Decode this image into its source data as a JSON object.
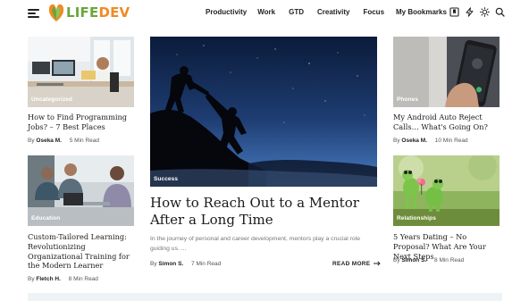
{
  "site": {
    "logo_part1": "LIFE",
    "logo_part2": "DEV",
    "brand_colors": {
      "life": "#6aa63a",
      "dev": "#f08a24"
    }
  },
  "nav": {
    "items": [
      "Productivity",
      "Work",
      "GTD",
      "Creativity",
      "Focus",
      "My Bookmarks"
    ]
  },
  "header_icons": [
    "bookmark-icon",
    "lightning-icon",
    "sun-icon",
    "search-icon"
  ],
  "hamburger_icon": "menu-icon",
  "articles": {
    "left_top": {
      "category": "Uncategorized",
      "title": "How to Find Programming Jobs? – 7 Best Places",
      "by": "By",
      "author": "Oseka M.",
      "read_time": "5 Min Read"
    },
    "left_bottom": {
      "category": "Education",
      "title": "Custom-Tailored Learning: Revolutionizing Organizational Training for the Modern Learner",
      "by": "By",
      "author": "Fletch H.",
      "read_time": "8 Min Read"
    },
    "hero": {
      "category": "Success",
      "title": "How to Reach Out to a Mentor After a Long Time",
      "excerpt": "In the journey of personal and career development, mentors play a crucial role guiding us. ...",
      "by": "By",
      "author": "Simon S.",
      "read_time": "7 Min Read",
      "read_more": "READ MORE",
      "read_more_icon": "arrow-right-icon"
    },
    "right_top": {
      "category": "Phones",
      "title": "My Android Auto Reject Calls… What's Going On?",
      "by": "By",
      "author": "Oseka M.",
      "read_time": "10 Min Read"
    },
    "right_bottom": {
      "category": "Relationships",
      "title": "5 Years Dating – No Proposal? What Are Your Next Steps",
      "by": "By",
      "author": "Simon S.",
      "read_time": "8 Min Read"
    }
  }
}
